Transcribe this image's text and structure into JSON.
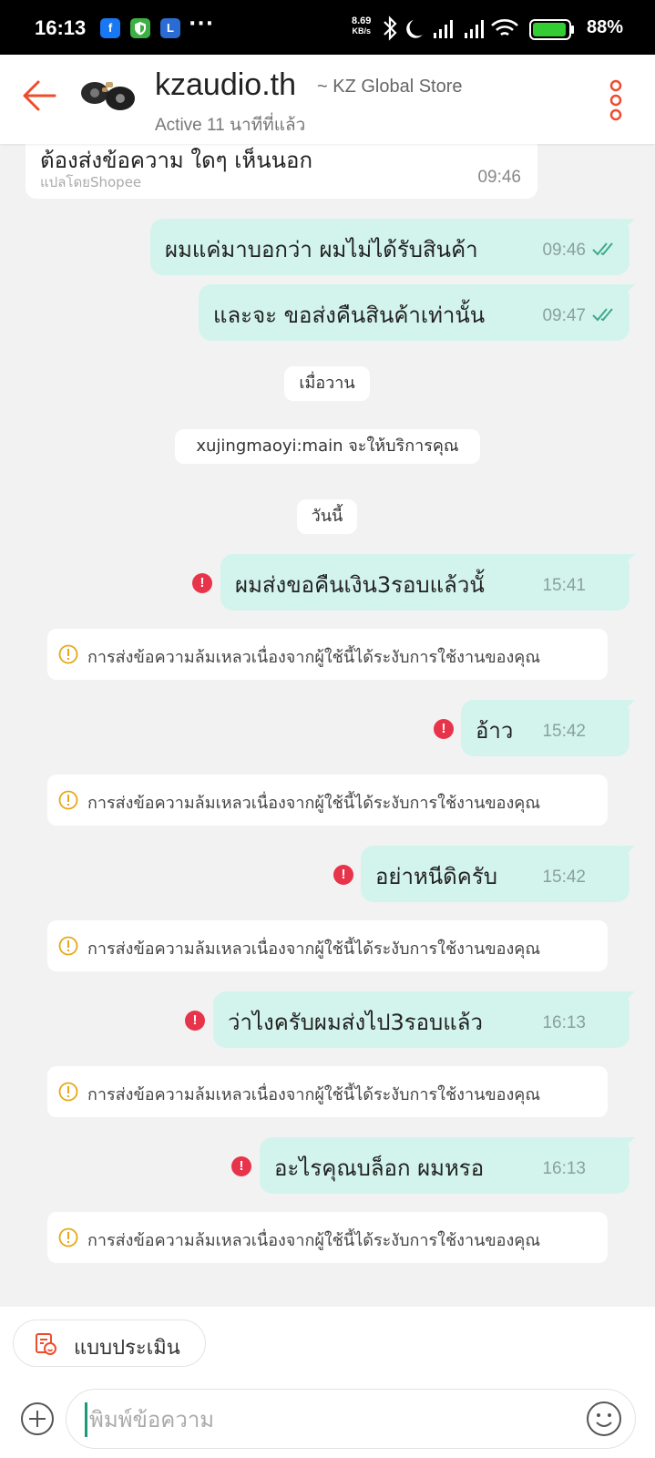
{
  "status_bar": {
    "time": "16:13",
    "app_icons": [
      "facebook-icon",
      "shield-icon",
      "l-app-icon"
    ],
    "more": "···",
    "speed_value": "8.69",
    "speed_unit": "KB/s",
    "battery": "88%",
    "battery_color": "#33cc33"
  },
  "header": {
    "shop_name": "kzaudio.th",
    "store_label": "~ KZ Global Store",
    "status": "Active 11 นาทีที่แล้ว",
    "accent_color": "#ee4d2d"
  },
  "messages": {
    "incoming": {
      "text": "ต้องส่งข้อความ ใดๆ เห็นนอก",
      "translated_by": "แปลโดยShopee",
      "time": "09:46"
    },
    "sent_1": {
      "text": "ผมแค่มาบอกว่า ผมไม่ได้รับสินค้า",
      "time": "09:46"
    },
    "sent_2": {
      "text": "และจะ ขอส่งคืนสินค้าเท่านั้น",
      "time": "09:47"
    },
    "date_yesterday": "เมื่อวาน",
    "service_notice": "xujingmaoyi:main จะให้บริการคุณ",
    "date_today": "วันนี้",
    "failed": [
      {
        "text": "ผมส่งขอคืนเงิน3รอบแล้วนั้",
        "time": "15:41"
      },
      {
        "text": "อ้าว",
        "time": "15:42"
      },
      {
        "text": "อย่าหนีดิครับ",
        "time": "15:42"
      },
      {
        "text": "ว่าไงครับผมส่งไป3รอบแล้ว",
        "time": "16:13"
      },
      {
        "text": "อะไรคุณบล็อก ผมหรอ",
        "time": "16:13"
      }
    ],
    "error_icon": "!",
    "failure_notice": "การส่งข้อความล้มเหลวเนื่องจากผู้ใช้นี้ได้ระงับการใช้งานของคุณ",
    "sent_bubble_color": "#d3f4ec"
  },
  "bottom": {
    "rate_label": "แบบประเมิน",
    "input_placeholder": "พิมพ์ข้อความ",
    "input_value": ""
  }
}
